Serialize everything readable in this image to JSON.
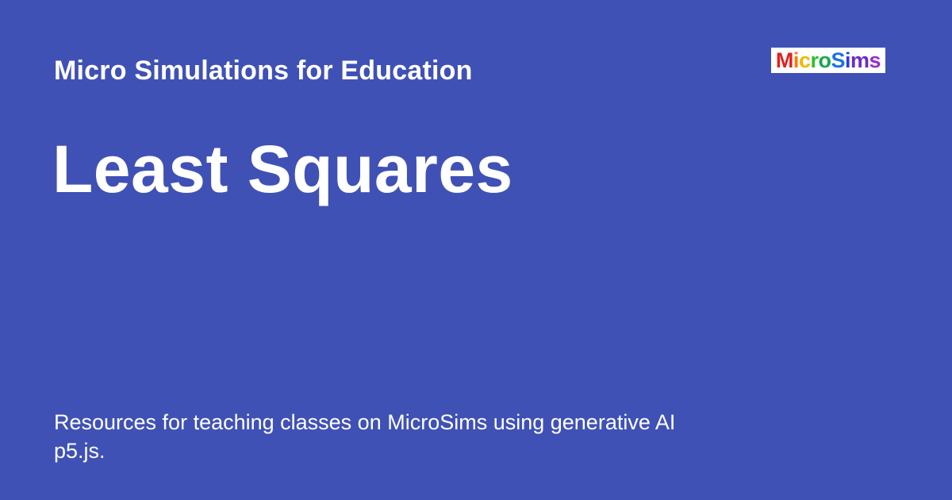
{
  "header": {
    "site_name": "Micro Simulations for Education"
  },
  "page": {
    "title": "Least Squares",
    "description_line1": "Resources for teaching classes on MicroSims using generative AI",
    "description_line2": "p5.js."
  },
  "logo": {
    "text": "MicroSims",
    "letter_colors": [
      "#e02020",
      "#ff7a00",
      "#f2b700",
      "#2fbf2f",
      "#17a84a",
      "#1a73e8",
      "#2b3fd9",
      "#6a2bc9",
      "#9b2bc9"
    ]
  },
  "colors": {
    "background": "#4051b5",
    "text": "#ffffff",
    "logo_background": "#ffffff"
  }
}
